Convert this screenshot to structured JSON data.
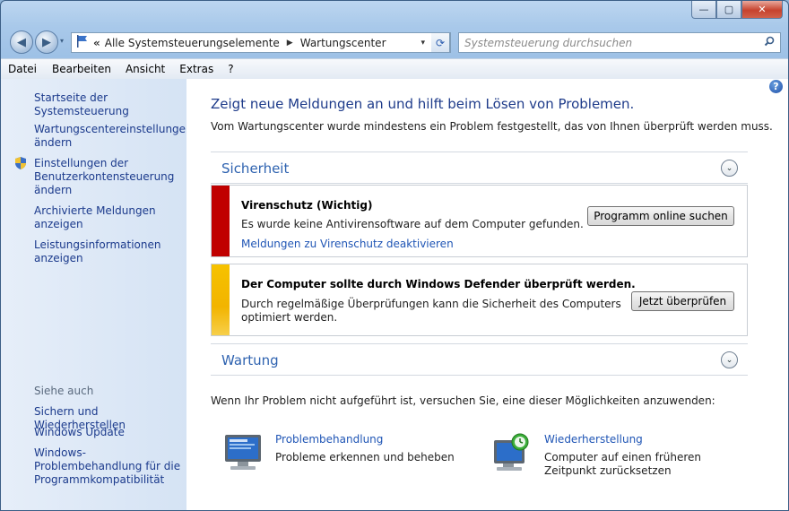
{
  "window": {
    "caption_minimize": "—",
    "caption_maximize": "▢",
    "caption_close": "✕"
  },
  "nav": {
    "back_glyph": "◀",
    "forward_glyph": "▶",
    "dropdown_glyph": "▾",
    "address_overflow": "«",
    "breadcrumbs": [
      "Alle Systemsteuerungselemente",
      "Wartungscenter"
    ],
    "crumb_sep": "▶",
    "address_dropdown": "▾",
    "refresh_glyph": "⟳",
    "search_placeholder": "Systemsteuerung durchsuchen",
    "search_glyph": "⚲"
  },
  "menu": {
    "items": [
      "Datei",
      "Bearbeiten",
      "Ansicht",
      "Extras",
      "?"
    ]
  },
  "sidebar": {
    "home": "Startseite der Systemsteuerung",
    "links": [
      "Wartungscentereinstellungen ändern",
      "Einstellungen der Benutzerkontensteuerung ändern",
      "Archivierte Meldungen anzeigen",
      "Leistungsinformationen anzeigen"
    ],
    "see_also_heading": "Siehe auch",
    "see_also": [
      "Sichern und Wiederherstellen",
      "Windows Update",
      "Windows-Problembehandlung für die Programmkompatibilität"
    ]
  },
  "main": {
    "help_glyph": "?",
    "title": "Zeigt neue Meldungen an und hilft beim Lösen von Problemen.",
    "subtitle": "Vom Wartungscenter wurde mindestens ein Problem festgestellt, das von Ihnen überprüft werden muss.",
    "security_heading": "Sicherheit",
    "maintenance_heading": "Wartung",
    "chevron_glyph": "⌄",
    "messages": [
      {
        "title": "Virenschutz  (Wichtig)",
        "text": "Es wurde keine Antivirensoftware auf dem Computer gefunden.",
        "link": "Meldungen zu Virenschutz deaktivieren",
        "button": "Programm online suchen",
        "color": "#c00000"
      },
      {
        "title": "Der Computer sollte durch Windows Defender überprüft werden.",
        "text": "Durch regelmäßige Überprüfungen kann die Sicherheit des Computers optimiert werden.",
        "button": "Jetzt überprüfen",
        "color": "#f2b400"
      }
    ],
    "hint": "Wenn Ihr Problem nicht aufgeführt ist, versuchen Sie, eine dieser Möglichkeiten anzuwenden:",
    "tools": [
      {
        "link": "Problembehandlung",
        "desc": "Probleme erkennen und beheben"
      },
      {
        "link": "Wiederherstellung",
        "desc_line1": "Computer auf einen früheren",
        "desc_line2": "Zeitpunkt zurücksetzen"
      }
    ]
  },
  "colors": {
    "accent_link": "#1f55b5",
    "heading_blue": "#2f63b0",
    "critical_red": "#c00000",
    "warning_yellow": "#f2b400"
  }
}
